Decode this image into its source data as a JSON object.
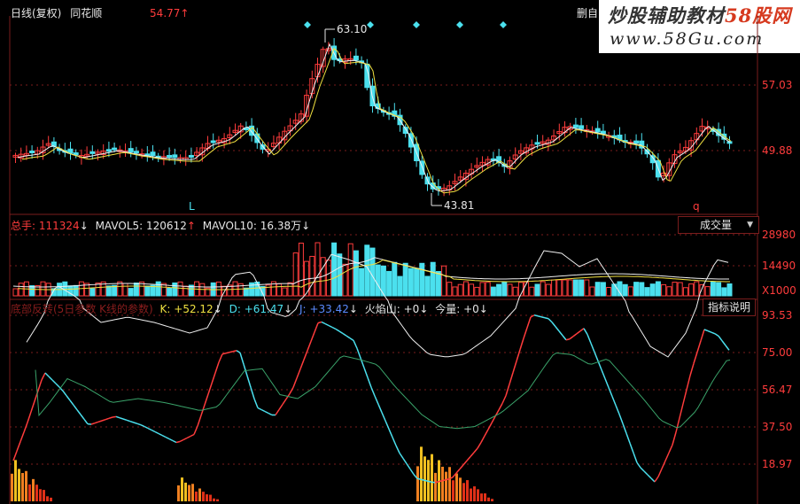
{
  "header": {
    "chart_mode": "日线(复权)",
    "stock_name": "同花顺",
    "last_price": "54.77",
    "last_arrow": "↑",
    "corner_text": "删自"
  },
  "price_panel": {
    "high_label": "63.10",
    "low_label": "43.81",
    "axis_labels": [
      "57.03",
      "49.88"
    ],
    "marker_L": "L",
    "marker_q": "q"
  },
  "volume_panel": {
    "total_label": "总手:",
    "total_value": "111324",
    "total_arrow": "↓",
    "mavol5_label": "MAVOL5:",
    "mavol5_value": "120612",
    "mavol5_arrow": "↑",
    "mavol10_label": "MAVOL10:",
    "mavol10_value": "16.38万",
    "mavol10_arrow": "↓",
    "indicator_select": "成交量",
    "axis_labels": [
      "28980",
      "14490",
      "X1000"
    ]
  },
  "indicator_panel": {
    "name_label": "底部反转(5日参数 K线的参数)",
    "k_label": "K:",
    "k_value": "+52.12",
    "k_arrow": "↓",
    "d_label": "D:",
    "d_value": "+61.47",
    "d_arrow": "↓",
    "j_label": "J:",
    "j_value": "+33.42",
    "j_arrow": "↓",
    "fire_label": "火焰山:",
    "fire_value": "+0",
    "fire_arrow": "↓",
    "vol_label": "今量:",
    "vol_value": "+0",
    "vol_arrow": "↓",
    "help_button": "指标说明",
    "axis_labels": [
      "93.53",
      "75.00",
      "56.47",
      "37.50",
      "18.97"
    ]
  },
  "watermark": {
    "line1_a": "炒股辅助教材",
    "line1_b": "58股网",
    "line2": "www.58Gu.com"
  },
  "colors": {
    "up": "#ff3c3c",
    "down": "#4be0ee",
    "grid": "#7a1d1d",
    "ma_white": "#f0f0f0",
    "ma_yellow": "#f0e040",
    "ma_green": "#3aa36a"
  }
}
